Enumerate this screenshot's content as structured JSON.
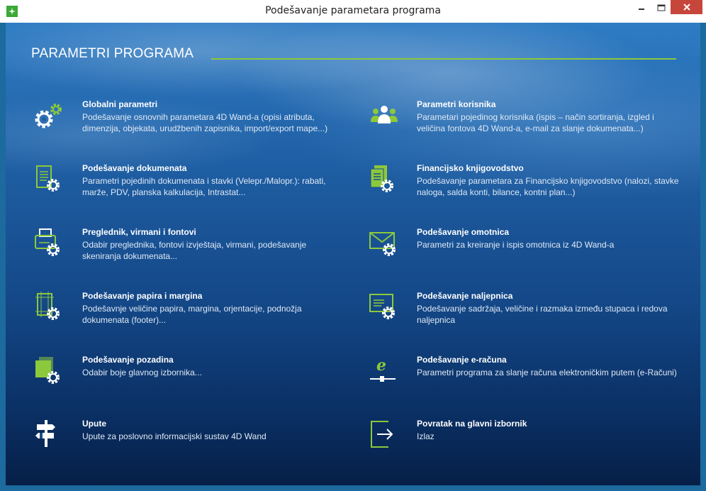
{
  "window": {
    "title": "Podešavanje parametara programa"
  },
  "colors": {
    "accent": "#8cc83c",
    "icon_white": "#ffffff",
    "close_red": "#c7463c"
  },
  "page": {
    "title": "PARAMETRI PROGRAMA"
  },
  "items": [
    {
      "label": "Globalni parametri",
      "desc": "Podešavanje osnovnih parametara 4D Wand-a (opisi atributa, dimenzija, objekata, urudžbenih zapisnika, import/export mape...)",
      "icon": "gears-icon"
    },
    {
      "label": "Parametri korisnika",
      "desc": "Parametari pojedinog korisnika (ispis – način sortiranja, izgled i veličina fontova 4D Wand-a, e-mail za slanje dokumenata...)",
      "icon": "users-icon"
    },
    {
      "label": "Podešavanje dokumenata",
      "desc": "Parametri pojedinih dokumenata i stavki (Velepr./Malopr.): rabati, marže, PDV, planska kalkulacija, Intrastat...",
      "icon": "document-gear-icon"
    },
    {
      "label": "Financijsko knjigovodstvo",
      "desc": "Podešavanje parametara za Financijsko knjigovodstvo (nalozi, stavke naloga, salda konti, bilance, kontni plan...)",
      "icon": "ledger-gear-icon"
    },
    {
      "label": "Preglednik, virmani i fontovi",
      "desc": "Odabir preglednika, fontovi izvještaja, virmani, podešavanje skeniranja dokumenata...",
      "icon": "printer-gear-icon"
    },
    {
      "label": "Podešavanje omotnica",
      "desc": "Parametri za kreiranje i ispis omotnica iz 4D Wand-a",
      "icon": "envelope-gear-icon"
    },
    {
      "label": "Podešavanje papira i margina",
      "desc": "Podešavnje veličine papira, margina, orjentacije, podnožja dokumenata (footer)...",
      "icon": "page-margins-gear-icon"
    },
    {
      "label": "Podešavanje naljepnica",
      "desc": "Podešavanje sadržaja, veličine i razmaka između stupaca i redova naljepnica",
      "icon": "label-gear-icon"
    },
    {
      "label": "Podešavanje pozadina",
      "desc": "Odabir boje glavnog izbornika...",
      "icon": "background-gear-icon"
    },
    {
      "label": "Podešavanje e-računa",
      "desc": "Parametri programa za slanje računa elektroničkim putem (e-Računi)",
      "icon": "e-invoice-icon"
    },
    {
      "label": "Upute",
      "desc": "Upute za poslovno informacijski sustav 4D Wand",
      "icon": "signpost-icon"
    },
    {
      "label": "Povratak na glavni izbornik",
      "desc": "Izlaz",
      "icon": "exit-icon"
    }
  ]
}
